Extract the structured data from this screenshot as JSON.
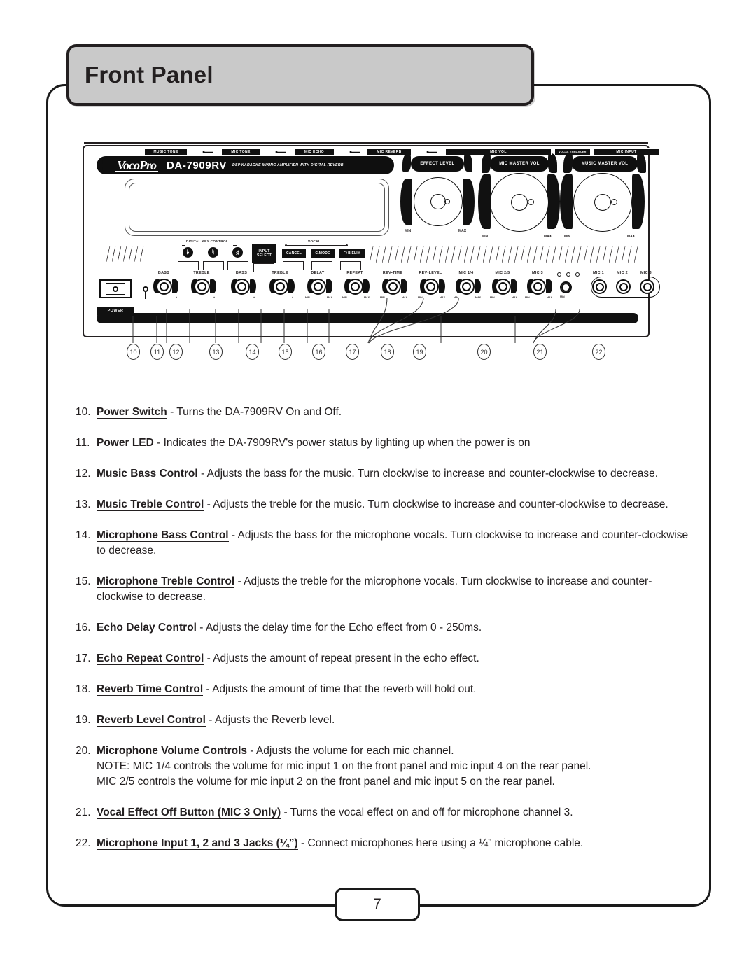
{
  "header": {
    "title": "Front Panel"
  },
  "footer": {
    "page_number": "7"
  },
  "device": {
    "brand": "VocoPro",
    "model": "DA-7909RV",
    "subtitle": "DSP KARAOKE MIXING AMPLIFIER WITH DIGITAL REVERB",
    "group_captions": {
      "digital_key_control": "DIGITAL KEY CONTROL",
      "vocal": "VOCAL"
    },
    "key_buttons": [
      {
        "glyph": "♭",
        "name": "flat"
      },
      {
        "glyph": "♮",
        "name": "natural"
      },
      {
        "glyph": "♯",
        "name": "sharp"
      }
    ],
    "input_select": "INPUT\nSELECT",
    "input_select_line1": "INPUT",
    "input_select_line2": "SELECT",
    "vocal_buttons": [
      "CANCEL",
      "C.MODE",
      "F+B ELIM"
    ],
    "power": {
      "label": "POWER"
    },
    "small_knobs": [
      {
        "label": "BASS",
        "min": "-",
        "max": "+",
        "group": "MUSIC TONE"
      },
      {
        "label": "TREBLE",
        "min": "-",
        "max": "+",
        "group": "MUSIC TONE"
      },
      {
        "label": "BASS",
        "min": "-",
        "max": "+",
        "group": "MIC TONE"
      },
      {
        "label": "TREBLE",
        "min": "-",
        "max": "+",
        "group": "MIC TONE"
      },
      {
        "label": "DELAY",
        "min": "MIN",
        "max": "MAX",
        "group": "MIC ECHO"
      },
      {
        "label": "REPEAT",
        "min": "MIN",
        "max": "MAX",
        "group": "MIC ECHO"
      },
      {
        "label": "REV•TIME",
        "min": "MIN",
        "max": "MAX",
        "group": "MIC REVERB"
      },
      {
        "label": "REV•LEVEL",
        "min": "MIN",
        "max": "MAX",
        "group": "MIC REVERB"
      },
      {
        "label": "MIC 1/4",
        "min": "MIN",
        "max": "MAX",
        "group": "MIC VOL"
      },
      {
        "label": "MIC 2/5",
        "min": "MIN",
        "max": "MAX",
        "group": "MIC VOL"
      },
      {
        "label": "MIC 3",
        "min": "MIN",
        "max": "MAX",
        "group": "MIC VOL"
      }
    ],
    "vocal_enhancer_knob": {
      "label": "",
      "min": "MIN"
    },
    "big_knobs": [
      {
        "label": "EFFECT LEVEL",
        "min": "MIN",
        "max": "MAX"
      },
      {
        "label": "MIC MASTER VOL",
        "min": "MIN",
        "max": "MAX"
      },
      {
        "label": "MUSIC MASTER VOL",
        "min": "MIN",
        "max": "MAX"
      }
    ],
    "mic_inputs": [
      "MIC 1",
      "MIC 2",
      "MIC 3"
    ],
    "strip_labels": [
      "MUSIC TONE",
      "MIC TONE",
      "MIC ECHO",
      "MIC REVERB",
      "MIC VOL",
      "VOCAL ENHANCER",
      "MIC INPUT"
    ],
    "callout_numbers": [
      "10",
      "11",
      "12",
      "13",
      "14",
      "15",
      "16",
      "17",
      "18",
      "19",
      "20",
      "21",
      "22"
    ]
  },
  "items": [
    {
      "num": "10.",
      "term": "Power Switch",
      "rest": " - Turns the DA-7909RV On and Off."
    },
    {
      "num": "11.",
      "term": "Power LED",
      "rest": " - Indicates the DA-7909RV's power status by lighting up when the power is on"
    },
    {
      "num": "12.",
      "term": "Music Bass Control",
      "rest": " - Adjusts the bass for the music.  Turn clockwise to increase and counter-clockwise to decrease."
    },
    {
      "num": "13.",
      "term": "Music Treble Control",
      "rest": " - Adjusts the treble for the music.  Turn clockwise to increase and counter-clockwise to decrease."
    },
    {
      "num": "14.",
      "term": "Microphone Bass Control",
      "rest": " - Adjusts the bass for the microphone vocals.  Turn clockwise to increase and counter-clockwise to decrease."
    },
    {
      "num": "15.",
      "term": "Microphone Treble Control",
      "rest": " - Adjusts the treble for the microphone vocals.  Turn clockwise to increase and counter-clockwise to decrease."
    },
    {
      "num": "16.",
      "term": "Echo Delay Control",
      "rest": " - Adjusts the delay time for the Echo effect from 0 - 250ms."
    },
    {
      "num": "17.",
      "term": "Echo Repeat Control",
      "rest": " - Adjusts the amount of repeat present in the echo effect."
    },
    {
      "num": "18.",
      "term": "Reverb Time Control",
      "rest": " - Adjusts the amount of time that the reverb will hold out."
    },
    {
      "num": "19.",
      "term": "Reverb Level Control",
      "rest": " - Adjusts the Reverb level."
    },
    {
      "num": "20.",
      "term": "Microphone Volume Controls",
      "rest": " - Adjusts the volume for each mic channel.",
      "note1": "NOTE: MIC 1/4 controls the volume for mic input 1 on the front panel and mic input 4 on the rear panel.",
      "note2": "MIC 2/5 controls the volume for mic input 2 on the front panel and mic input 5 on the rear panel."
    },
    {
      "num": "21.",
      "term": "Vocal Effect Off Button (MIC 3 Only)",
      "rest": " - Turns the vocal effect on and off for microphone channel 3."
    },
    {
      "num": "22.",
      "term": "Microphone Input 1, 2 and 3 Jacks (¼”)",
      "rest": " - Connect microphones here using a ¼” microphone cable."
    }
  ]
}
